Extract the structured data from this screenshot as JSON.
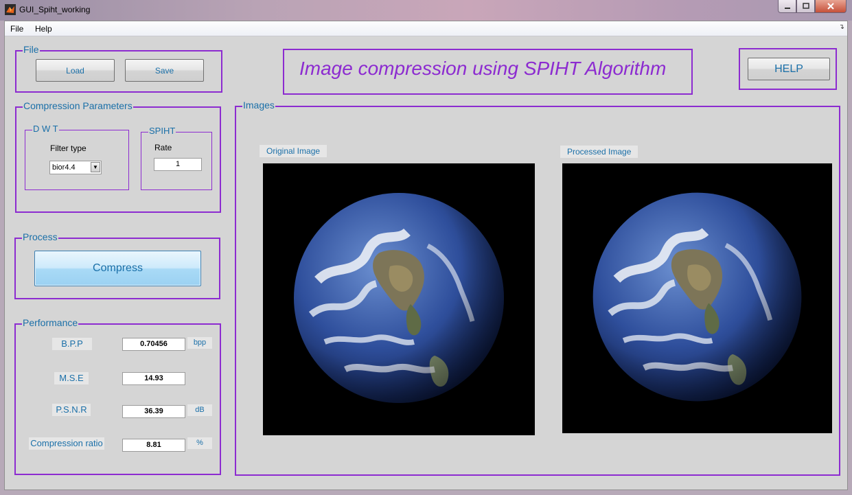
{
  "window": {
    "title": "GUI_Spiht_working",
    "controls": [
      "minimize",
      "maximize",
      "close"
    ]
  },
  "menu": {
    "items": [
      {
        "label": "File"
      },
      {
        "label": "Help"
      }
    ]
  },
  "file_panel": {
    "title": "File",
    "load_label": "Load",
    "save_label": "Save"
  },
  "banner": {
    "title": "Image compression using SPIHT Algorithm"
  },
  "help_button": {
    "label": "HELP"
  },
  "compression_params": {
    "title": "Compression Parameters",
    "dwt": {
      "title": "D W T",
      "filter_label": "Filter type",
      "filter_value": "bior4.4"
    },
    "spiht": {
      "title": "SPIHT",
      "rate_label": "Rate",
      "rate_value": "1"
    }
  },
  "process": {
    "title": "Process",
    "compress_label": "Compress"
  },
  "performance": {
    "title": "Performance",
    "metrics": [
      {
        "label": "B.P.P",
        "value": "0.70456",
        "unit": "bpp"
      },
      {
        "label": "M.S.E",
        "value": "14.93",
        "unit": ""
      },
      {
        "label": "P.S.N.R",
        "value": "36.39",
        "unit": "dB"
      },
      {
        "label": "Compression ratio",
        "value": "8.81",
        "unit": "%"
      }
    ]
  },
  "images": {
    "title": "Images",
    "original_label": "Original Image",
    "processed_label": "Processed Image"
  },
  "colors": {
    "panel_border": "#8c2bd0",
    "label_blue": "#1a6fa8",
    "background": "#d5d5d5"
  }
}
